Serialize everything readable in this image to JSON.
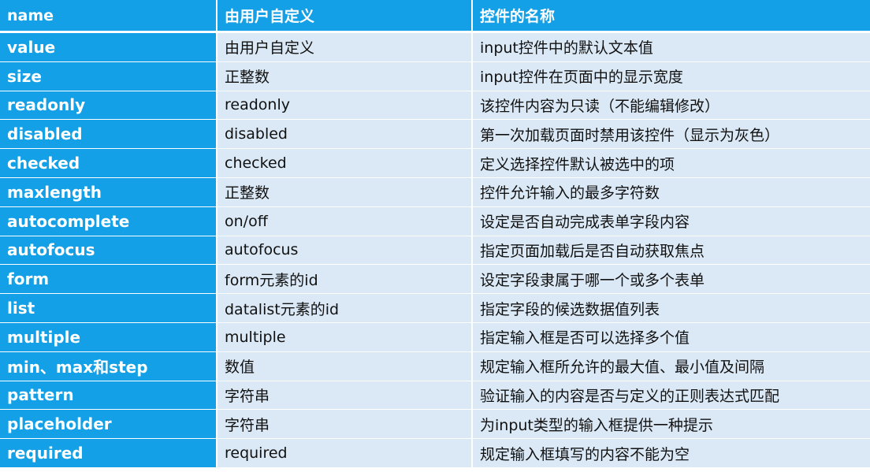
{
  "table": {
    "headers": [
      "name",
      "由用户自定义",
      "控件的名称"
    ],
    "rows": [
      [
        "value",
        "由用户自定义",
        "input控件中的默认文本值"
      ],
      [
        "size",
        "正整数",
        "input控件在页面中的显示宽度"
      ],
      [
        "readonly",
        "readonly",
        "该控件内容为只读（不能编辑修改）"
      ],
      [
        "disabled",
        "disabled",
        "第一次加载页面时禁用该控件（显示为灰色）"
      ],
      [
        "checked",
        "checked",
        "定义选择控件默认被选中的项"
      ],
      [
        "maxlength",
        "正整数",
        "控件允许输入的最多字符数"
      ],
      [
        "autocomplete",
        "on/off",
        "设定是否自动完成表单字段内容"
      ],
      [
        "autofocus",
        "autofocus",
        "指定页面加载后是否自动获取焦点"
      ],
      [
        "form",
        "form元素的id",
        "设定字段隶属于哪一个或多个表单"
      ],
      [
        "list",
        "datalist元素的id",
        "指定字段的候选数据值列表"
      ],
      [
        "multiple",
        "multiple",
        "指定输入框是否可以选择多个值"
      ],
      [
        "min、max和step",
        "数值",
        "规定输入框所允许的最大值、最小值及间隔"
      ],
      [
        "pattern",
        "字符串",
        "验证输入的内容是否与定义的正则表达式匹配"
      ],
      [
        "placeholder",
        "字符串",
        "为input类型的输入框提供一种提示"
      ],
      [
        "required",
        "required",
        "规定输入框填写的内容不能为空"
      ]
    ]
  },
  "colors": {
    "header_bg": "#13a0e6",
    "row_bg": "#dbe9f6"
  }
}
